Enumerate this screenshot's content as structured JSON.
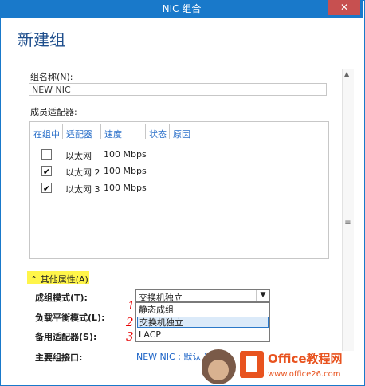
{
  "window": {
    "title": "NIC 组合",
    "close_label": "✕"
  },
  "heading": "新建组",
  "form": {
    "team_name_label": "组名称(N):",
    "team_name_value": "NEW NIC",
    "members_label": "成员适配器:"
  },
  "table": {
    "columns": [
      "在组中",
      "适配器",
      "速度",
      "状态",
      "原因"
    ],
    "rows": [
      {
        "checked": false,
        "adapter": "以太网",
        "speed": "100 Mbps"
      },
      {
        "checked": true,
        "adapter": "以太网 2",
        "speed": "100 Mbps"
      },
      {
        "checked": true,
        "adapter": "以太网 3",
        "speed": "100 Mbps"
      }
    ]
  },
  "properties": {
    "toggle_label": "其他属性(A)",
    "teaming_mode_label": "成组模式(T):",
    "teaming_mode_value": "交换机独立",
    "load_balancing_label": "负载平衡模式(L):",
    "standby_label": "备用适配器(S):",
    "primary_label": "主要组接口:",
    "primary_value": "NEW NIC ; 默认 )",
    "options": [
      "静态成组",
      "交换机独立",
      "LACP"
    ]
  },
  "annotations": [
    "1",
    "2",
    "3"
  ],
  "watermark": {
    "brand": "Office教程网",
    "url": "www.office26.com"
  },
  "colors": {
    "titlebar": "#1979ca",
    "accent": "#1e4e8c",
    "highlight": "#fff54a",
    "annotation": "#e60000",
    "logo_orange": "#e8531f"
  }
}
